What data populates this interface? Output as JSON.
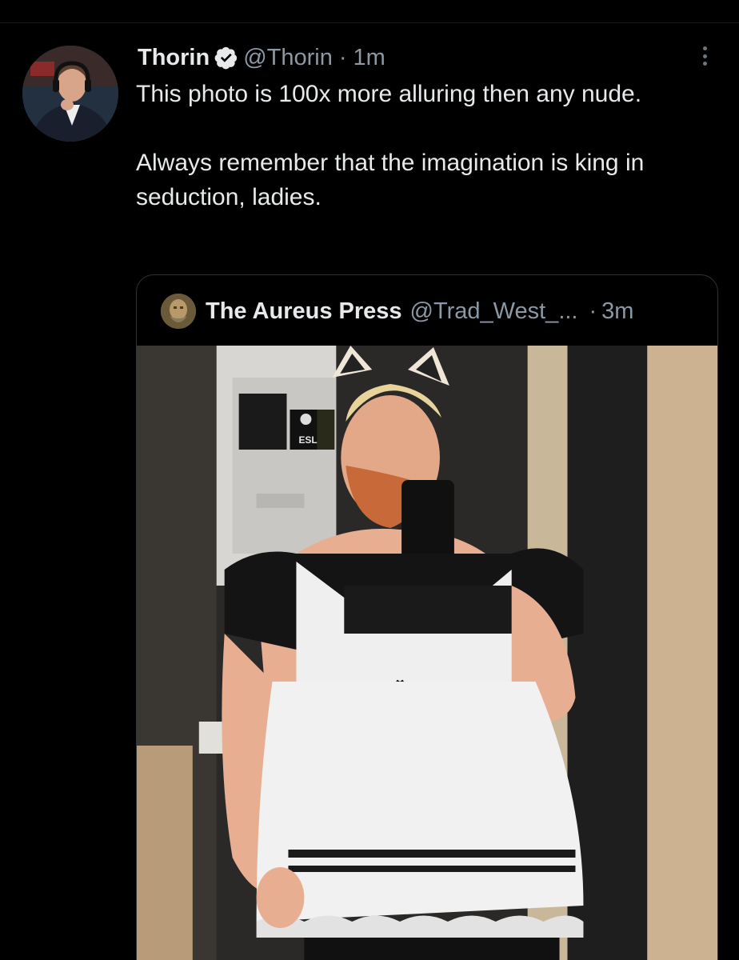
{
  "tweet": {
    "author_name": "Thorin",
    "author_handle": "@Thorin",
    "separator": "·",
    "time": "1m",
    "text_line1": "This photo is 100x more alluring then any nude.",
    "text_line2": "Always remember that the imagination is king in seduction, ladies.",
    "verified_icon": "verified-badge-icon",
    "more_icon": "more-options-icon"
  },
  "quote": {
    "author_name": "The Aureus Press",
    "author_handle": "@Trad_West_...",
    "separator": "·",
    "time": "3m",
    "photo_sign_text": "ESL"
  },
  "colors": {
    "background": "#000000",
    "text": "#e7e9ea",
    "secondary_text": "#8b98a5",
    "verified_blue": "#1d9bf0",
    "border": "#2f3336"
  }
}
